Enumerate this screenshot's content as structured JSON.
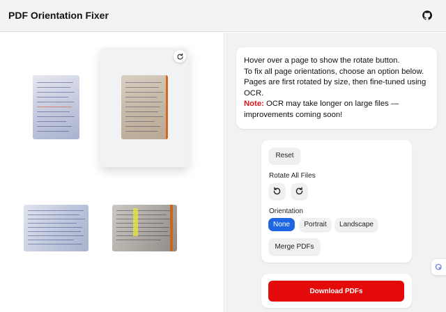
{
  "header": {
    "title": "PDF Orientation Fixer",
    "github_icon": "github-icon"
  },
  "pages": [
    {
      "orientation": "portrait",
      "style": "blue-notes"
    },
    {
      "orientation": "portrait",
      "style": "sepia-notes",
      "hovered": true
    },
    {
      "orientation": "landscape",
      "style": "blue-notes"
    },
    {
      "orientation": "landscape",
      "style": "dark-notes"
    }
  ],
  "info": {
    "line1": "Hover over a page to show the rotate button.",
    "line2": "To fix all page orientations, choose an option below.",
    "line3": "Pages are first rotated by size, then fine-tuned using OCR.",
    "note_label": "Note:",
    "note_text": " OCR may take longer on large files — improvements coming soon!"
  },
  "controls": {
    "reset_label": "Reset",
    "rotate_all_label": "Rotate All Files",
    "orientation_label": "Orientation",
    "orientation_options": [
      "None",
      "Portrait",
      "Landscape"
    ],
    "orientation_selected": "None",
    "merge_label": "Merge PDFs"
  },
  "download": {
    "label": "Download PDFs"
  },
  "colors": {
    "accent": "#1f66e5",
    "download": "#e50a0a",
    "note": "#e0141d"
  }
}
